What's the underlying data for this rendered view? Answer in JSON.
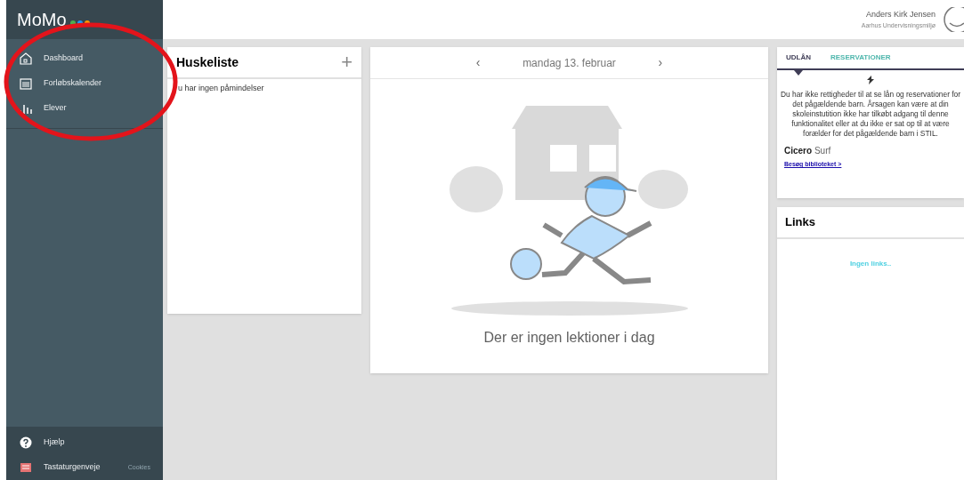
{
  "sidebar": {
    "logo": "MoMo",
    "items": [
      {
        "label": "Dashboard",
        "kind": "house"
      },
      {
        "label": "Forløbskalender",
        "kind": "calendar"
      },
      {
        "label": "Elever",
        "kind": "bars"
      }
    ],
    "footer_items": [
      {
        "label": "Hjælp",
        "kind": "help"
      },
      {
        "label": "Tastaturgenveje",
        "kind": "keyboard"
      }
    ],
    "cookies_link": "Cookies"
  },
  "user": {
    "name": "Anders Kirk Jensen",
    "organization": "Aarhus Undervisningsmiljø"
  },
  "reminders": {
    "title": "Huskeliste",
    "add_button": "+",
    "empty_text": "u har ingen påmindelser"
  },
  "lessons": {
    "prev": "‹",
    "date": "mandag 13. februar",
    "next": "›",
    "empty_text": "Der er ingen lektioner i dag"
  },
  "library": {
    "tabs": [
      {
        "label": "UDLÅN",
        "selected": true
      },
      {
        "label": "RESERVATIONER",
        "selected": false
      }
    ],
    "message": "Du har ikke rettigheder til at se lån og reservationer for det pågældende barn. Årsagen kan være at din skoleinstutition ikke har tilkøbt adgang til denne funktionalitet eller at du ikke er sat op til at være forælder for det pågældende barn i STIL.",
    "brand_bold": "Cicero",
    "brand_light": "Surf",
    "link": "Besøg biblioteket >"
  },
  "links": {
    "title": "Links",
    "empty_text": "Ingen links.."
  }
}
